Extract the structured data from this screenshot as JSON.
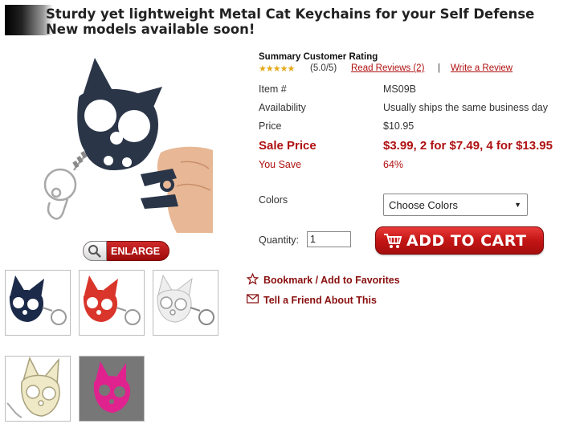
{
  "header": {
    "title_line1": "Sturdy yet lightweight Metal Cat Keychains for your Self Defense",
    "title_line2": "New models available soon!"
  },
  "gallery": {
    "enlarge_label": "ENLARGE",
    "thumbnails": [
      {
        "color_name": "navy",
        "color": "#1c2a4a"
      },
      {
        "color_name": "red",
        "color": "#d9352a"
      },
      {
        "color_name": "white",
        "color": "#f2f2f2"
      },
      {
        "color_name": "ivory",
        "color": "#efe9c8"
      },
      {
        "color_name": "pink",
        "color": "#e0228f"
      }
    ]
  },
  "rating": {
    "title": "Summary Customer Rating",
    "stars": "★★★★★",
    "score": "(5.0/5)",
    "reviews_link": "Read Reviews (2)",
    "separator": "|",
    "write_review_link": "Write a Review"
  },
  "details": {
    "item_label": "Item #",
    "item_value": "MS09B",
    "availability_label": "Availability",
    "availability_value": "Usually ships the same business day",
    "price_label": "Price",
    "price_value": "$10.95",
    "sale_label": "Sale Price",
    "sale_value": "$3.99, 2 for $7.49, 4 for $13.95",
    "save_label": "You Save",
    "save_value": "64%"
  },
  "options": {
    "colors_label": "Colors",
    "colors_selected": "Choose Colors",
    "quantity_label": "Quantity:",
    "quantity_value": "1"
  },
  "actions": {
    "add_to_cart": "ADD TO CART",
    "bookmark": "Bookmark / Add to Favorites",
    "tell_friend": "Tell a Friend About This"
  },
  "colors": {
    "accent_red": "#b01010",
    "keychain_main": "#2a3548"
  }
}
